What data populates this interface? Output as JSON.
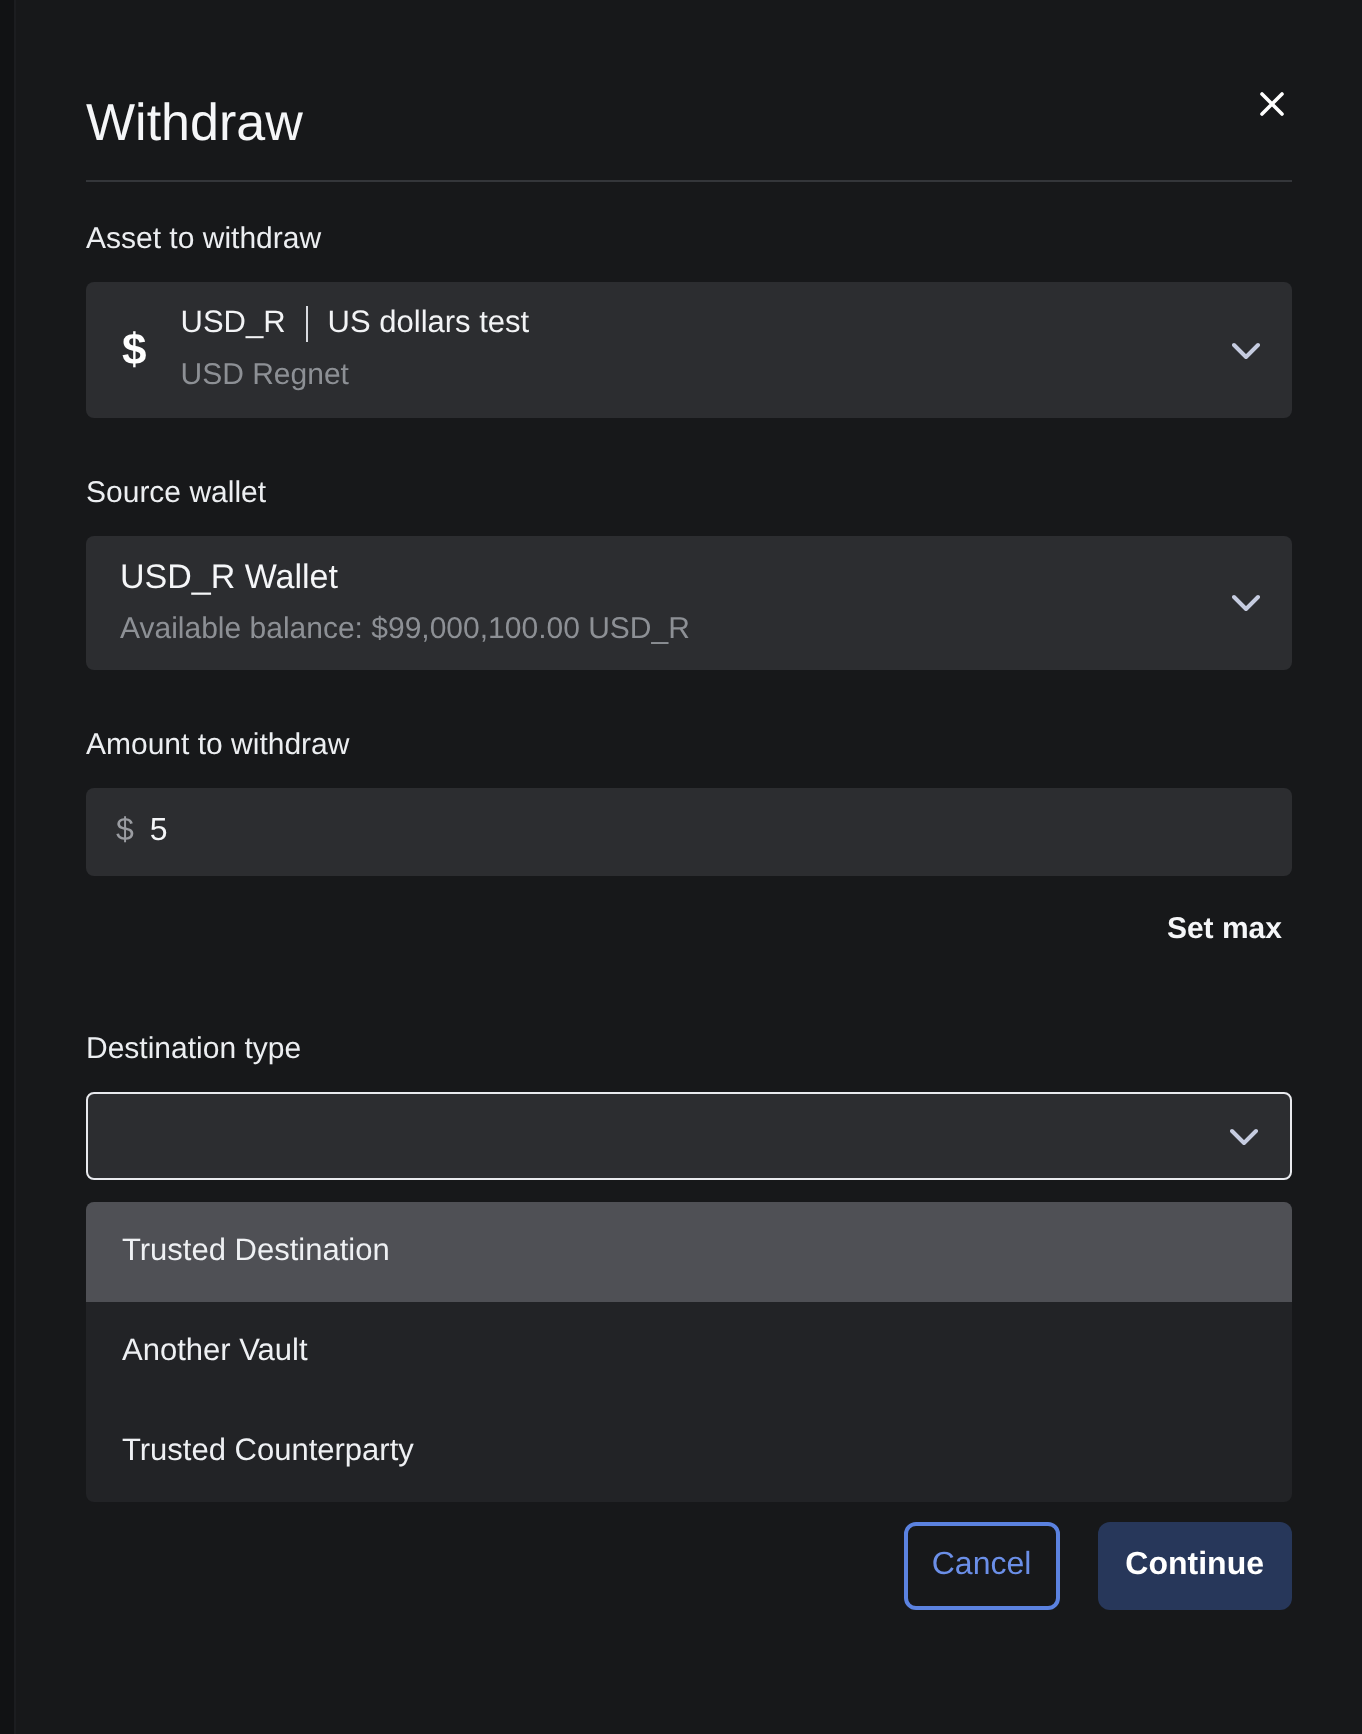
{
  "dialog": {
    "title": "Withdraw"
  },
  "asset": {
    "label": "Asset to withdraw",
    "symbol": "$",
    "code": "USD_R",
    "name": "US dollars test",
    "network": "USD Regnet"
  },
  "source_wallet": {
    "label": "Source wallet",
    "name": "USD_R Wallet",
    "balance": "Available balance: $99,000,100.00 USD_R"
  },
  "amount": {
    "label": "Amount to withdraw",
    "prefix": "$",
    "value": "5",
    "set_max": "Set max"
  },
  "destination_type": {
    "label": "Destination type",
    "focused": true,
    "options": [
      {
        "label": "Trusted Destination",
        "selected": true
      },
      {
        "label": "Another Vault",
        "selected": false
      },
      {
        "label": "Trusted Counterparty",
        "selected": false
      }
    ]
  },
  "buttons": [
    {
      "label": "Cancel",
      "kind": "outline"
    },
    {
      "label": "Continue",
      "kind": "primary"
    }
  ]
}
